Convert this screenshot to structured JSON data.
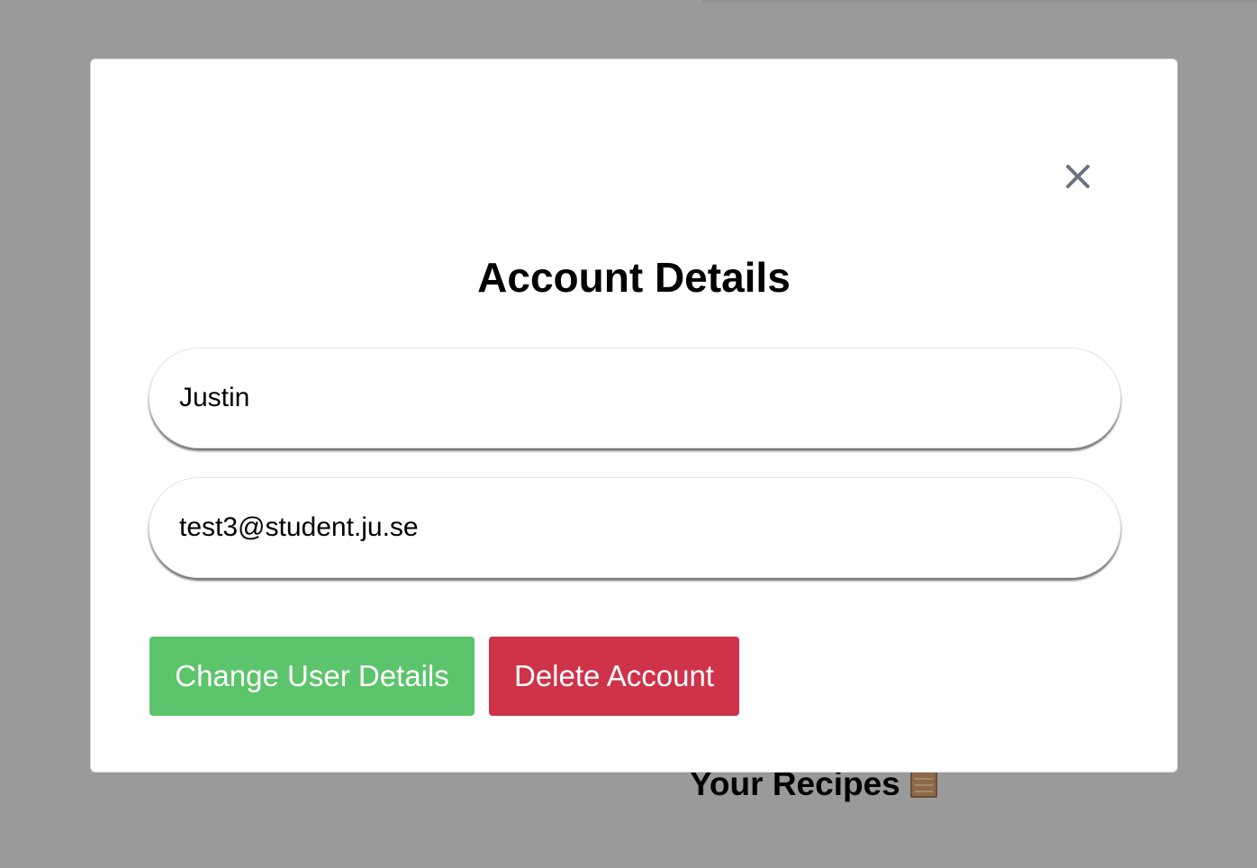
{
  "background": {
    "heading": "Your Recipes",
    "heading_icon": "scroll-icon"
  },
  "modal": {
    "title": "Account Details",
    "close_icon": "close-icon",
    "name_value": "Justin",
    "email_value": "test3@student.ju.se",
    "change_button_label": "Change User Details",
    "delete_button_label": "Delete Account"
  },
  "colors": {
    "overlay": "#9a9a9a",
    "change_button": "#5cc46b",
    "delete_button": "#cf3349",
    "close_icon": "#6b7280"
  }
}
